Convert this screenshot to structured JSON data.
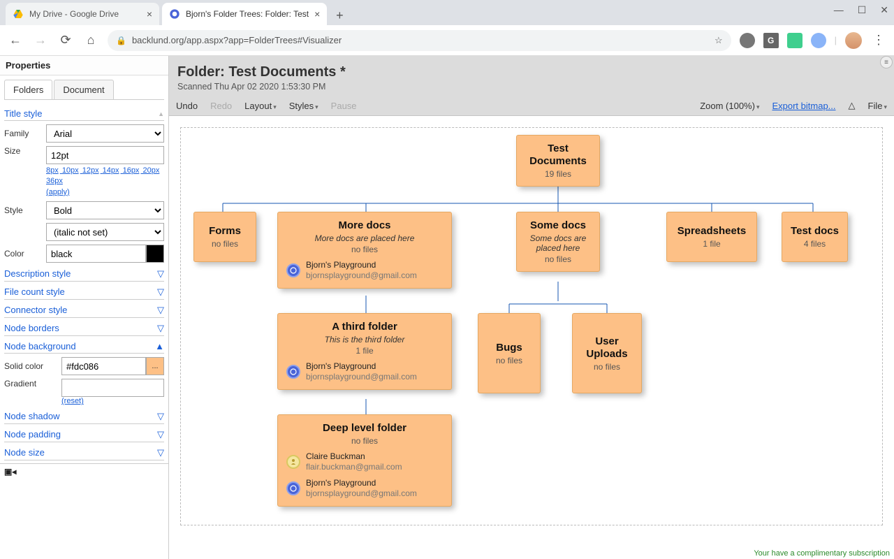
{
  "browser": {
    "tabs": [
      {
        "title": "My Drive - Google Drive"
      },
      {
        "title": "Bjorn's Folder Trees: Folder: Test"
      }
    ],
    "url_display": "backlund.org/app.aspx?app=FolderTrees#Visualizer"
  },
  "sidebar": {
    "header": "Properties",
    "tab_folders": "Folders",
    "tab_document": "Document",
    "title_style": "Title style",
    "family_label": "Family",
    "family_value": "Arial",
    "size_label": "Size",
    "size_value": "12pt",
    "size_presets": [
      "8px",
      "10px",
      "12px",
      "14px",
      "16px",
      "20px",
      "36px"
    ],
    "size_apply": "(apply)",
    "style_label": "Style",
    "style_bold": "Bold",
    "style_italic": "(italic not set)",
    "color_label": "Color",
    "color_value": "black",
    "heads": {
      "desc": "Description style",
      "filecount": "File count style",
      "connector": "Connector style",
      "borders": "Node borders",
      "background": "Node background",
      "shadow": "Node shadow",
      "padding": "Node padding",
      "size": "Node size"
    },
    "solid_label": "Solid color",
    "solid_value": "#fdc086",
    "gradient_label": "Gradient",
    "reset": "(reset)"
  },
  "header": {
    "title": "Folder: Test Documents *",
    "scanned": "Scanned Thu Apr 02 2020 1:53:30 PM"
  },
  "menu": {
    "undo": "Undo",
    "redo": "Redo",
    "layout": "Layout",
    "styles": "Styles",
    "pause": "Pause",
    "zoom": "Zoom (100%)",
    "export": "Export bitmap...",
    "file": "File"
  },
  "chart_data": {
    "type": "tree",
    "root": {
      "title": "Test Documents",
      "file_count_label": "19 files",
      "children": [
        {
          "title": "Forms",
          "file_count_label": "no files"
        },
        {
          "title": "More docs",
          "description": "More docs are placed here",
          "file_count_label": "no files",
          "owners": [
            {
              "name": "Bjorn's Playground",
              "email": "bjornsplayground@gmail.com",
              "icon": "blue"
            }
          ],
          "children": [
            {
              "title": "A third folder",
              "description": "This is the third folder",
              "file_count_label": "1 file",
              "owners": [
                {
                  "name": "Bjorn's Playground",
                  "email": "bjornsplayground@gmail.com",
                  "icon": "blue"
                }
              ],
              "children": [
                {
                  "title": "Deep level folder",
                  "file_count_label": "no files",
                  "owners": [
                    {
                      "name": "Claire Buckman",
                      "email": "flair.buckman@gmail.com",
                      "icon": "pawn"
                    },
                    {
                      "name": "Bjorn's Playground",
                      "email": "bjornsplayground@gmail.com",
                      "icon": "blue"
                    }
                  ]
                }
              ]
            }
          ]
        },
        {
          "title": "Some docs",
          "description": "Some docs are placed here",
          "file_count_label": "no files",
          "children": [
            {
              "title": "Bugs",
              "file_count_label": "no files"
            },
            {
              "title": "User Uploads",
              "file_count_label": "no files"
            }
          ]
        },
        {
          "title": "Spreadsheets",
          "file_count_label": "1 file"
        },
        {
          "title": "Test docs",
          "file_count_label": "4 files"
        }
      ]
    }
  },
  "footer": {
    "compliment": "Your have a complimentary subscription"
  }
}
